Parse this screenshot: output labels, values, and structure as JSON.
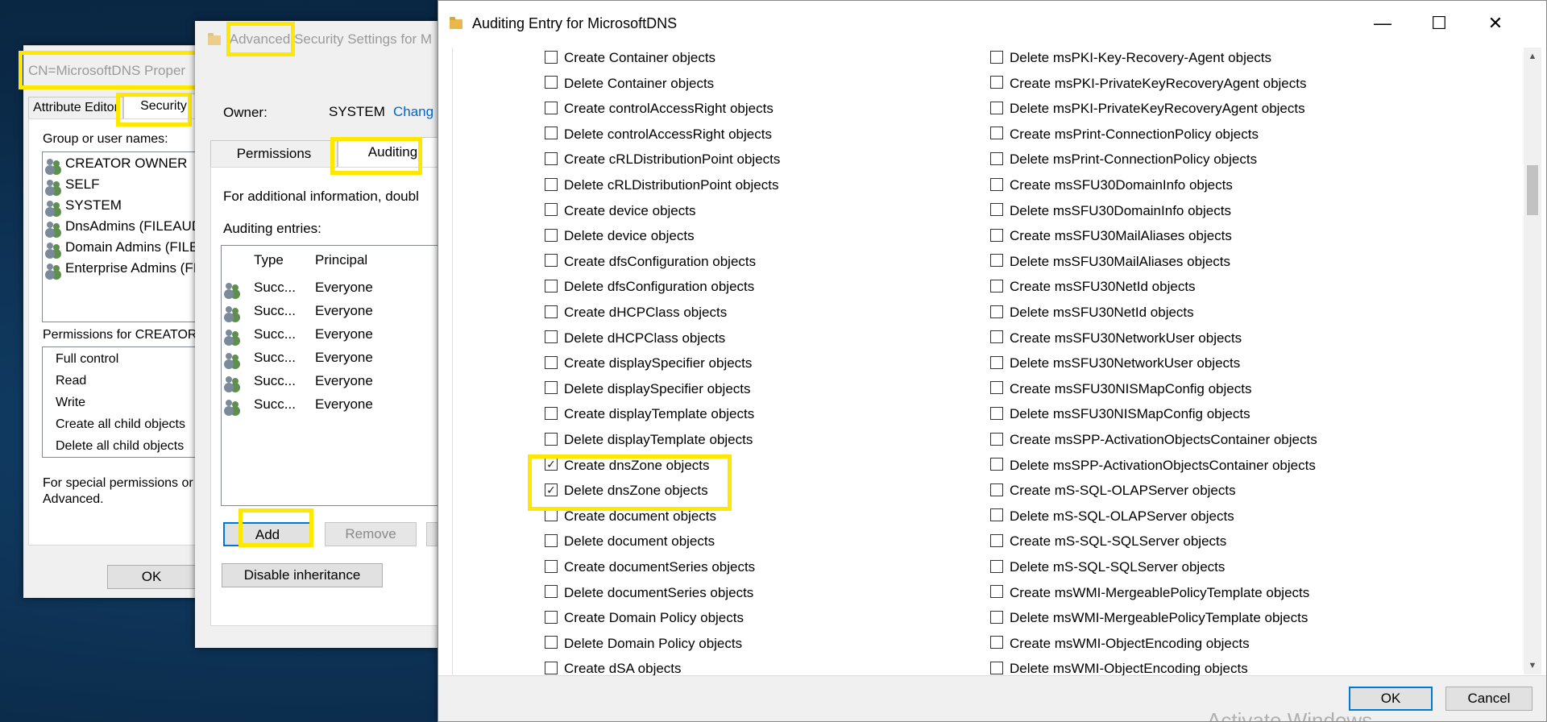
{
  "props_window": {
    "title": "CN=MicrosoftDNS Proper",
    "tabs": [
      "Attribute Editor",
      "Security"
    ],
    "group_label": "Group or user names:",
    "users": [
      "CREATOR OWNER",
      "SELF",
      "SYSTEM",
      "DnsAdmins (FILEAUD",
      "Domain Admins (FILE",
      "Enterprise Admins (FIL"
    ],
    "perms_label": "Permissions for CREATOR",
    "perms": [
      "Full control",
      "Read",
      "Write",
      "Create all child objects",
      "Delete all child objects"
    ],
    "special_text_1": "For special permissions or a",
    "special_text_2": "Advanced.",
    "ok_label": "OK"
  },
  "adv_window": {
    "title_prefix": "Advanced",
    "title_rest": " Security Settings for M",
    "owner_label": "Owner:",
    "owner_value": "SYSTEM",
    "owner_change": "Chang",
    "tabs": [
      "Permissions",
      "Auditing"
    ],
    "info_text": "For additional information, doubl",
    "entries_label": "Auditing entries:",
    "columns": [
      "Type",
      "Principal"
    ],
    "entries": [
      {
        "type": "Succ...",
        "principal": "Everyone"
      },
      {
        "type": "Succ...",
        "principal": "Everyone"
      },
      {
        "type": "Succ...",
        "principal": "Everyone"
      },
      {
        "type": "Succ...",
        "principal": "Everyone"
      },
      {
        "type": "Succ...",
        "principal": "Everyone"
      },
      {
        "type": "Succ...",
        "principal": "Everyone"
      }
    ],
    "add_label": "Add",
    "remove_label": "Remove",
    "disable_label": "Disable inheritance"
  },
  "entry_window": {
    "title": "Auditing Entry for MicrosoftDNS",
    "ok_label": "OK",
    "cancel_label": "Cancel",
    "watermark": "Activate Windows",
    "left_col": [
      {
        "label": "Create Container objects",
        "checked": false
      },
      {
        "label": "Delete Container objects",
        "checked": false
      },
      {
        "label": "Create controlAccessRight objects",
        "checked": false
      },
      {
        "label": "Delete controlAccessRight objects",
        "checked": false
      },
      {
        "label": "Create cRLDistributionPoint objects",
        "checked": false
      },
      {
        "label": "Delete cRLDistributionPoint objects",
        "checked": false
      },
      {
        "label": "Create device objects",
        "checked": false
      },
      {
        "label": "Delete device objects",
        "checked": false
      },
      {
        "label": "Create dfsConfiguration objects",
        "checked": false
      },
      {
        "label": "Delete dfsConfiguration objects",
        "checked": false
      },
      {
        "label": "Create dHCPClass objects",
        "checked": false
      },
      {
        "label": "Delete dHCPClass objects",
        "checked": false
      },
      {
        "label": "Create displaySpecifier objects",
        "checked": false
      },
      {
        "label": "Delete displaySpecifier objects",
        "checked": false
      },
      {
        "label": "Create displayTemplate objects",
        "checked": false
      },
      {
        "label": "Delete displayTemplate objects",
        "checked": false
      },
      {
        "label": "Create dnsZone objects",
        "checked": true
      },
      {
        "label": "Delete dnsZone objects",
        "checked": true
      },
      {
        "label": "Create document objects",
        "checked": false
      },
      {
        "label": "Delete document objects",
        "checked": false
      },
      {
        "label": "Create documentSeries objects",
        "checked": false
      },
      {
        "label": "Delete documentSeries objects",
        "checked": false
      },
      {
        "label": "Create Domain Policy objects",
        "checked": false
      },
      {
        "label": "Delete Domain Policy objects",
        "checked": false
      },
      {
        "label": "Create dSA objects",
        "checked": false
      }
    ],
    "right_col": [
      {
        "label": "Delete msPKI-Key-Recovery-Agent objects",
        "checked": false
      },
      {
        "label": "Create msPKI-PrivateKeyRecoveryAgent objects",
        "checked": false
      },
      {
        "label": "Delete msPKI-PrivateKeyRecoveryAgent objects",
        "checked": false
      },
      {
        "label": "Create msPrint-ConnectionPolicy objects",
        "checked": false
      },
      {
        "label": "Delete msPrint-ConnectionPolicy objects",
        "checked": false
      },
      {
        "label": "Create msSFU30DomainInfo objects",
        "checked": false
      },
      {
        "label": "Delete msSFU30DomainInfo objects",
        "checked": false
      },
      {
        "label": "Create msSFU30MailAliases objects",
        "checked": false
      },
      {
        "label": "Delete msSFU30MailAliases objects",
        "checked": false
      },
      {
        "label": "Create msSFU30NetId objects",
        "checked": false
      },
      {
        "label": "Delete msSFU30NetId objects",
        "checked": false
      },
      {
        "label": "Create msSFU30NetworkUser objects",
        "checked": false
      },
      {
        "label": "Delete msSFU30NetworkUser objects",
        "checked": false
      },
      {
        "label": "Create msSFU30NISMapConfig objects",
        "checked": false
      },
      {
        "label": "Delete msSFU30NISMapConfig objects",
        "checked": false
      },
      {
        "label": "Create msSPP-ActivationObjectsContainer objects",
        "checked": false
      },
      {
        "label": "Delete msSPP-ActivationObjectsContainer objects",
        "checked": false
      },
      {
        "label": "Create mS-SQL-OLAPServer objects",
        "checked": false
      },
      {
        "label": "Delete mS-SQL-OLAPServer objects",
        "checked": false
      },
      {
        "label": "Create mS-SQL-SQLServer objects",
        "checked": false
      },
      {
        "label": "Delete mS-SQL-SQLServer objects",
        "checked": false
      },
      {
        "label": "Create msWMI-MergeablePolicyTemplate objects",
        "checked": false
      },
      {
        "label": "Delete msWMI-MergeablePolicyTemplate objects",
        "checked": false
      },
      {
        "label": "Create msWMI-ObjectEncoding objects",
        "checked": false
      },
      {
        "label": "Delete msWMI-ObjectEncoding objects",
        "checked": false
      }
    ]
  },
  "colors": {
    "highlight": "#ffe800",
    "link": "#0066cc",
    "accent": "#0078d7"
  }
}
